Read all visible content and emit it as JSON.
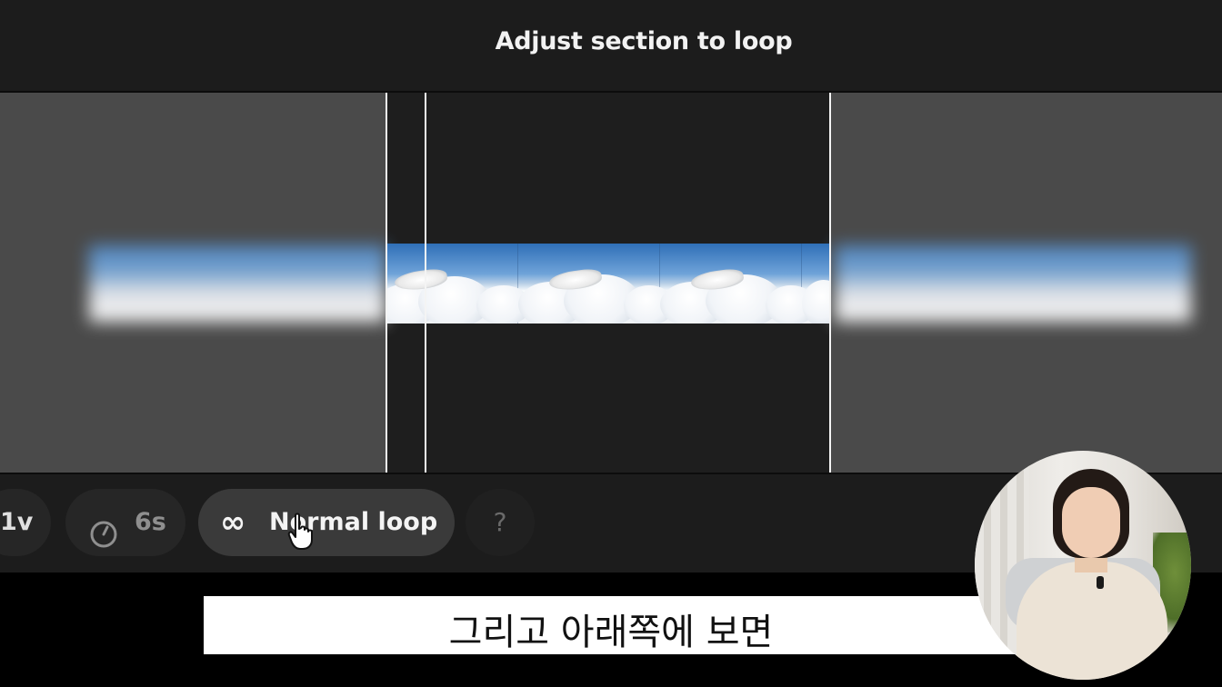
{
  "header": {
    "title": "Adjust section to loop"
  },
  "timeline": {
    "frames": [
      "frame-1",
      "frame-2",
      "frame-3"
    ]
  },
  "controls": {
    "version_label": "1v",
    "duration_label": "6s",
    "loop_label": "Normal loop",
    "help_label": "?"
  },
  "icons": {
    "duration": "clock-icon",
    "loop": "infinity-icon",
    "cursor": "hand-pointer-icon"
  },
  "subtitle": {
    "text": "그리고 아래쪽에 보면"
  },
  "colors": {
    "header_bg": "#1c1c1c",
    "active_pill_bg": "#3a3a3a",
    "sky_blue": "#2f6fb7"
  }
}
